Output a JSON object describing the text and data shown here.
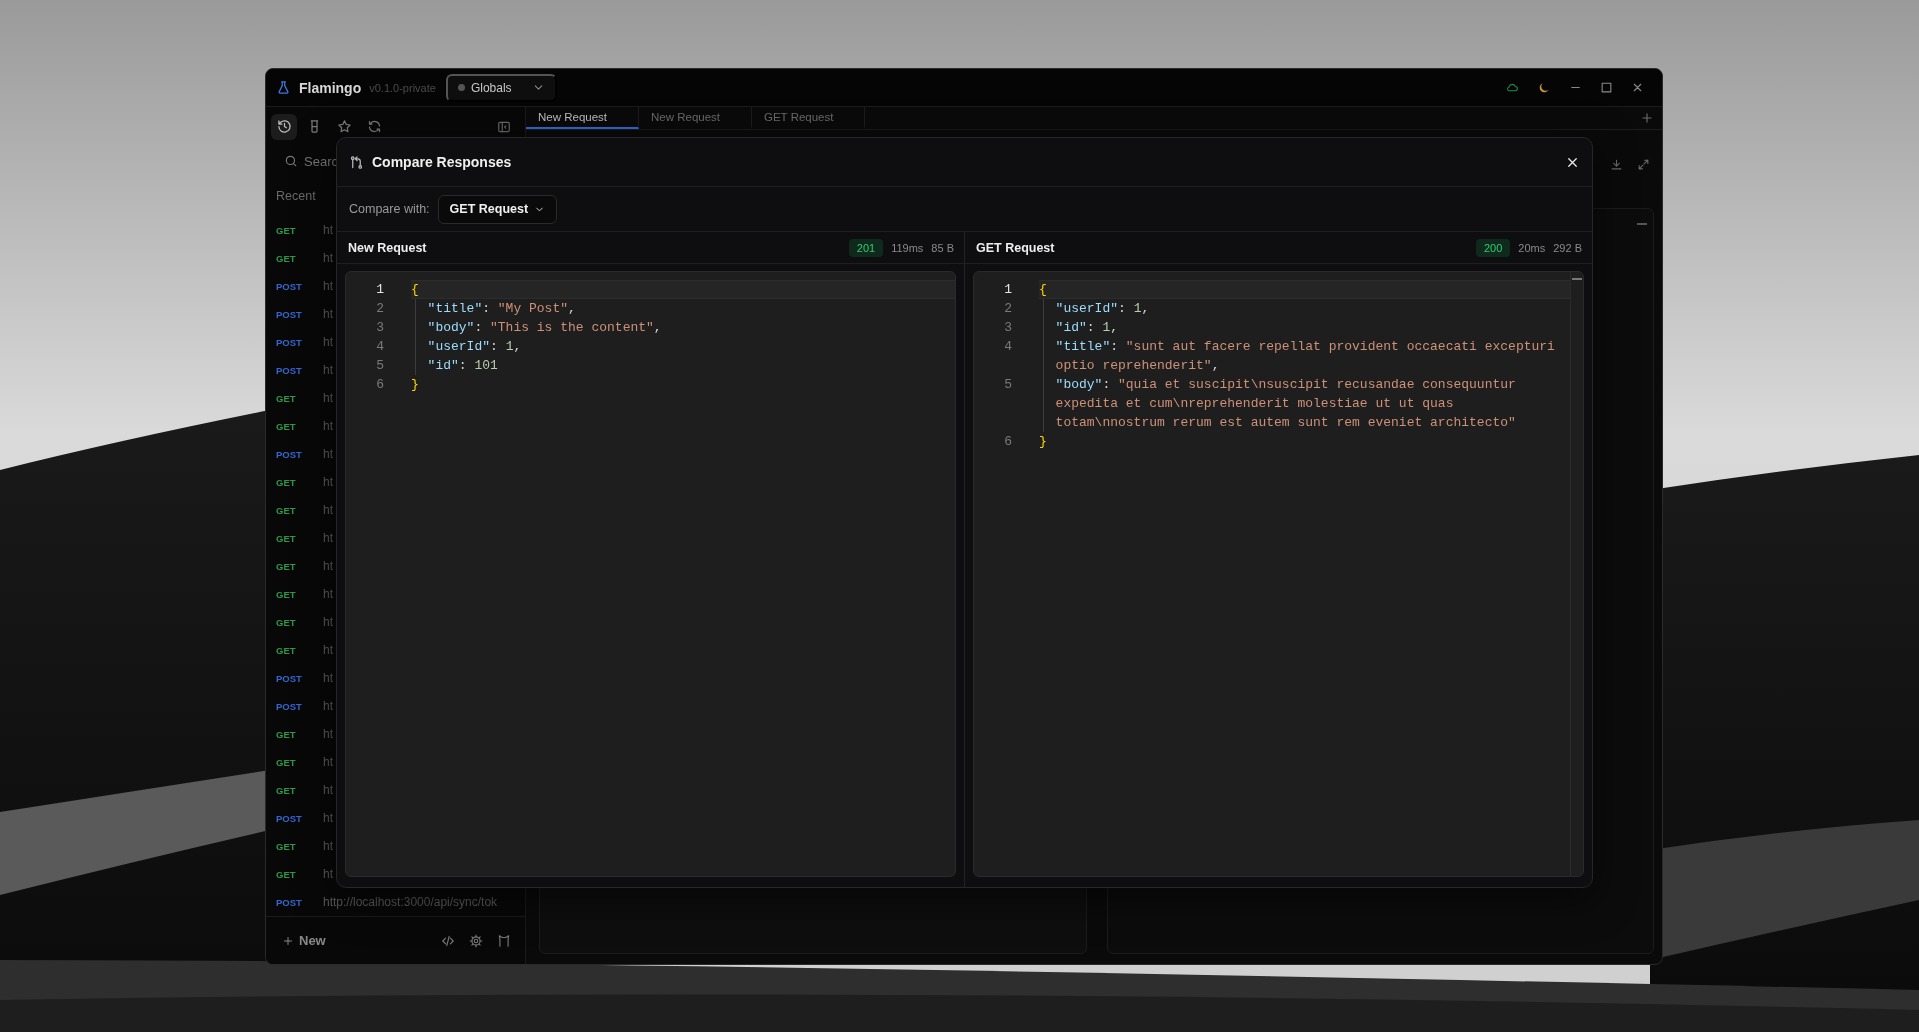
{
  "window": {
    "app_name": "Flamingo",
    "version": "v0.1.0-private",
    "environment": {
      "label": "Globals"
    }
  },
  "sidebar": {
    "tools": [
      {
        "selected": true
      },
      {
        "selected": false
      },
      {
        "selected": false
      },
      {
        "selected": false
      }
    ],
    "search": {
      "placeholder": "Searc"
    },
    "section_title": "Recent",
    "history": [
      {
        "method": "GET",
        "color": "#2a9a48",
        "url": "ht"
      },
      {
        "method": "GET",
        "color": "#2a9a48",
        "url": "ht"
      },
      {
        "method": "POST",
        "color": "#3566d0",
        "url": "ht"
      },
      {
        "method": "POST",
        "color": "#3566d0",
        "url": "ht"
      },
      {
        "method": "POST",
        "color": "#3566d0",
        "url": "ht"
      },
      {
        "method": "POST",
        "color": "#3566d0",
        "url": "ht"
      },
      {
        "method": "GET",
        "color": "#2a9a48",
        "url": "ht"
      },
      {
        "method": "GET",
        "color": "#2a9a48",
        "url": "ht"
      },
      {
        "method": "POST",
        "color": "#3566d0",
        "url": "ht"
      },
      {
        "method": "GET",
        "color": "#2a9a48",
        "url": "ht"
      },
      {
        "method": "GET",
        "color": "#2a9a48",
        "url": "ht"
      },
      {
        "method": "GET",
        "color": "#2a9a48",
        "url": "ht"
      },
      {
        "method": "GET",
        "color": "#2a9a48",
        "url": "ht"
      },
      {
        "method": "GET",
        "color": "#2a9a48",
        "url": "ht"
      },
      {
        "method": "GET",
        "color": "#2a9a48",
        "url": "ht"
      },
      {
        "method": "GET",
        "color": "#2a9a48",
        "url": "ht"
      },
      {
        "method": "POST",
        "color": "#3566d0",
        "url": "ht"
      },
      {
        "method": "POST",
        "color": "#3566d0",
        "url": "ht"
      },
      {
        "method": "GET",
        "color": "#2a9a48",
        "url": "ht"
      },
      {
        "method": "GET",
        "color": "#2a9a48",
        "url": "ht"
      },
      {
        "method": "GET",
        "color": "#2a9a48",
        "url": "ht"
      },
      {
        "method": "POST",
        "color": "#3566d0",
        "url": "ht"
      },
      {
        "method": "GET",
        "color": "#2a9a48",
        "url": "ht"
      },
      {
        "method": "GET",
        "color": "#2a9a48",
        "url": "ht"
      },
      {
        "method": "POST",
        "color": "#3566d0",
        "url": "http://localhost:3000/api/sync/tok"
      }
    ],
    "new_button": "New"
  },
  "tabs": [
    {
      "label": "New Request",
      "selected": true
    },
    {
      "label": "New Request",
      "selected": false
    },
    {
      "label": "GET Request",
      "selected": false
    }
  ],
  "modal": {
    "title": "Compare Responses",
    "compare_label": "Compare with:",
    "compare_value": "GET Request",
    "panes": [
      {
        "title": "New Request",
        "status": "201",
        "time": "119ms",
        "size": "85 B",
        "lines": [
          {
            "number": "1",
            "current": true,
            "indent": false,
            "tokens": [
              {
                "kind": "brace",
                "text": "{"
              }
            ]
          },
          {
            "number": "2",
            "current": false,
            "indent": true,
            "tokens": [
              {
                "kind": "key",
                "text": "\"title\""
              },
              {
                "kind": "punct",
                "text": ": "
              },
              {
                "kind": "string",
                "text": "\"My Post\""
              },
              {
                "kind": "punct",
                "text": ","
              }
            ]
          },
          {
            "number": "3",
            "current": false,
            "indent": true,
            "tokens": [
              {
                "kind": "key",
                "text": "\"body\""
              },
              {
                "kind": "punct",
                "text": ": "
              },
              {
                "kind": "string",
                "text": "\"This is the content\""
              },
              {
                "kind": "punct",
                "text": ","
              }
            ]
          },
          {
            "number": "4",
            "current": false,
            "indent": true,
            "tokens": [
              {
                "kind": "key",
                "text": "\"userId\""
              },
              {
                "kind": "punct",
                "text": ": "
              },
              {
                "kind": "number",
                "text": "1"
              },
              {
                "kind": "punct",
                "text": ","
              }
            ]
          },
          {
            "number": "5",
            "current": false,
            "indent": true,
            "tokens": [
              {
                "kind": "key",
                "text": "\"id\""
              },
              {
                "kind": "punct",
                "text": ": "
              },
              {
                "kind": "number",
                "text": "101"
              }
            ]
          },
          {
            "number": "6",
            "current": false,
            "indent": false,
            "tokens": [
              {
                "kind": "brace",
                "text": "}"
              }
            ]
          }
        ]
      },
      {
        "title": "GET Request",
        "status": "200",
        "time": "20ms",
        "size": "292 B",
        "lines": [
          {
            "number": "1",
            "current": true,
            "indent": false,
            "tokens": [
              {
                "kind": "brace",
                "text": "{"
              }
            ]
          },
          {
            "number": "2",
            "current": false,
            "indent": true,
            "tokens": [
              {
                "kind": "key",
                "text": "\"userId\""
              },
              {
                "kind": "punct",
                "text": ": "
              },
              {
                "kind": "number",
                "text": "1"
              },
              {
                "kind": "punct",
                "text": ","
              }
            ]
          },
          {
            "number": "3",
            "current": false,
            "indent": true,
            "tokens": [
              {
                "kind": "key",
                "text": "\"id\""
              },
              {
                "kind": "punct",
                "text": ": "
              },
              {
                "kind": "number",
                "text": "1"
              },
              {
                "kind": "punct",
                "text": ","
              }
            ]
          },
          {
            "number": "4",
            "current": false,
            "indent": true,
            "tokens": [
              {
                "kind": "key",
                "text": "\"title\""
              },
              {
                "kind": "punct",
                "text": ": "
              },
              {
                "kind": "string",
                "text": "\"sunt aut facere repellat provident occaecati excepturi optio reprehenderit\""
              },
              {
                "kind": "punct",
                "text": ","
              }
            ]
          },
          {
            "number": "5",
            "current": false,
            "indent": true,
            "tokens": [
              {
                "kind": "key",
                "text": "\"body\""
              },
              {
                "kind": "punct",
                "text": ": "
              },
              {
                "kind": "string",
                "text": "\"quia et suscipit\\nsuscipit recusandae consequuntur expedita et cum\\nreprehenderit molestiae ut ut quas totam\\nnostrum rerum est autem sunt rem eveniet architecto\""
              }
            ]
          },
          {
            "number": "6",
            "current": false,
            "indent": false,
            "tokens": [
              {
                "kind": "brace",
                "text": "}"
              }
            ]
          }
        ]
      }
    ]
  }
}
